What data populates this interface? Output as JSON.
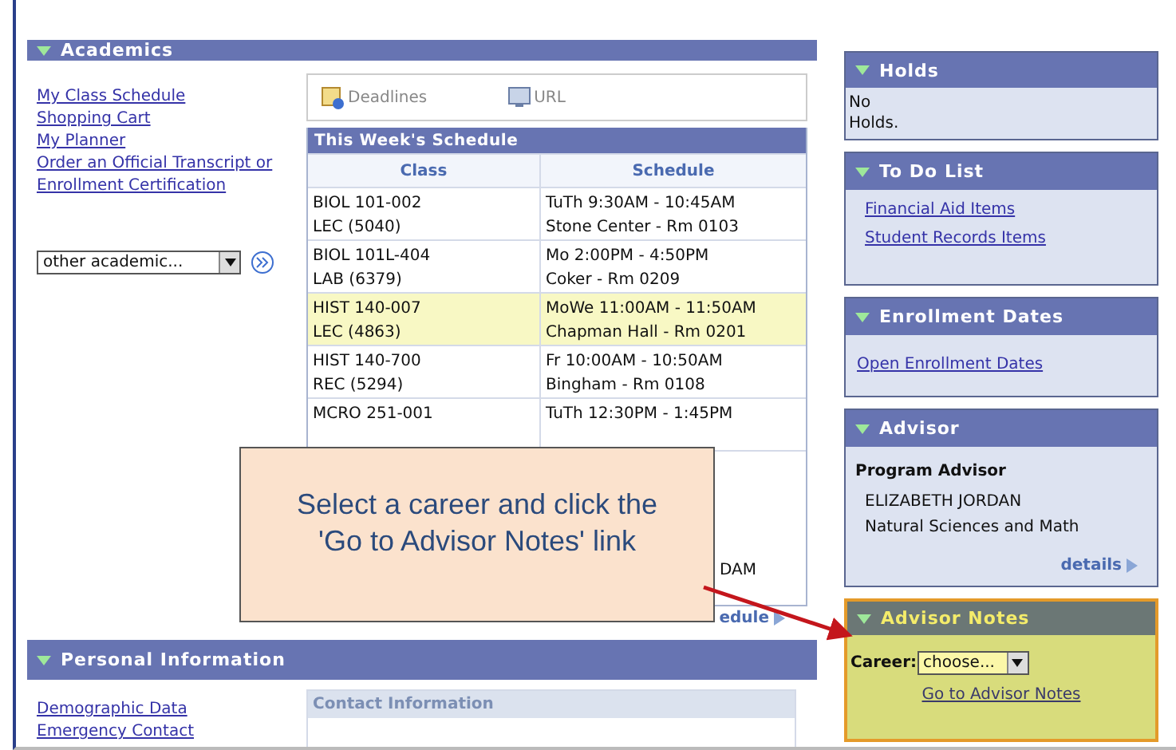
{
  "academics": {
    "title": "Academics",
    "links": [
      "My Class Schedule",
      "Shopping Cart",
      "My Planner",
      "Order an Official Transcript or",
      "Enrollment Certification"
    ],
    "dropdown": {
      "value": "other academic..."
    },
    "toolbar": [
      {
        "label": "Deadlines",
        "kind": "deadlines"
      },
      {
        "label": "URL",
        "kind": "url"
      }
    ],
    "schedule": {
      "title": "This Week's Schedule",
      "columns": [
        "Class",
        "Schedule"
      ],
      "rows": [
        {
          "kind": "full",
          "selected": false,
          "class": [
            "BIOL 101-002",
            "LEC (5040)"
          ],
          "schedule": [
            "TuTh 9:30AM - 10:45AM",
            "Stone Center - Rm 0103"
          ]
        },
        {
          "kind": "full",
          "selected": false,
          "class": [
            "BIOL 101L-404",
            "LAB (6379)"
          ],
          "schedule": [
            "Mo 2:00PM - 4:50PM",
            "Coker - Rm 0209"
          ]
        },
        {
          "kind": "full",
          "selected": true,
          "class": [
            "HIST 140-007",
            "LEC (4863)"
          ],
          "schedule": [
            "MoWe 11:00AM - 11:50AM",
            "Chapman Hall - Rm 0201"
          ]
        },
        {
          "kind": "full",
          "selected": false,
          "class": [
            "HIST 140-700",
            "REC (5294)"
          ],
          "schedule": [
            "Fr 10:00AM - 10:50AM",
            "Bingham - Rm 0108"
          ]
        },
        {
          "kind": "full",
          "selected": false,
          "class": [
            "MCRO 251-001"
          ],
          "schedule": [
            "TuTh 12:30PM - 1:45PM"
          ]
        },
        {
          "kind": "covered",
          "selected": false,
          "schedule": [
            "DAM"
          ]
        }
      ]
    },
    "schedule_link": "edule"
  },
  "callout": {
    "lines": [
      "Select a career and click the",
      "'Go to Advisor Notes' link"
    ]
  },
  "personal_information": {
    "title": "Personal Information",
    "links": [
      "Demographic Data",
      "Emergency Contact"
    ],
    "contact_box": {
      "title": "Contact Information"
    }
  },
  "holds": {
    "title": "Holds",
    "lines": [
      "No",
      "Holds."
    ]
  },
  "to_do_list": {
    "title": "To Do List",
    "links": [
      "Financial Aid Items",
      "Student Records Items"
    ]
  },
  "enrollment_dates": {
    "title": "Enrollment Dates",
    "links": [
      "Open Enrollment Dates"
    ]
  },
  "advisor": {
    "title": "Advisor",
    "heading": "Program Advisor",
    "lines": [
      "ELIZABETH JORDAN",
      "Natural Sciences and Math"
    ],
    "link": "details"
  },
  "advisor_notes": {
    "title": "Advisor Notes",
    "label": "Career:",
    "dropdown": {
      "value": "choose..."
    },
    "link": "Go to Advisor Notes"
  }
}
